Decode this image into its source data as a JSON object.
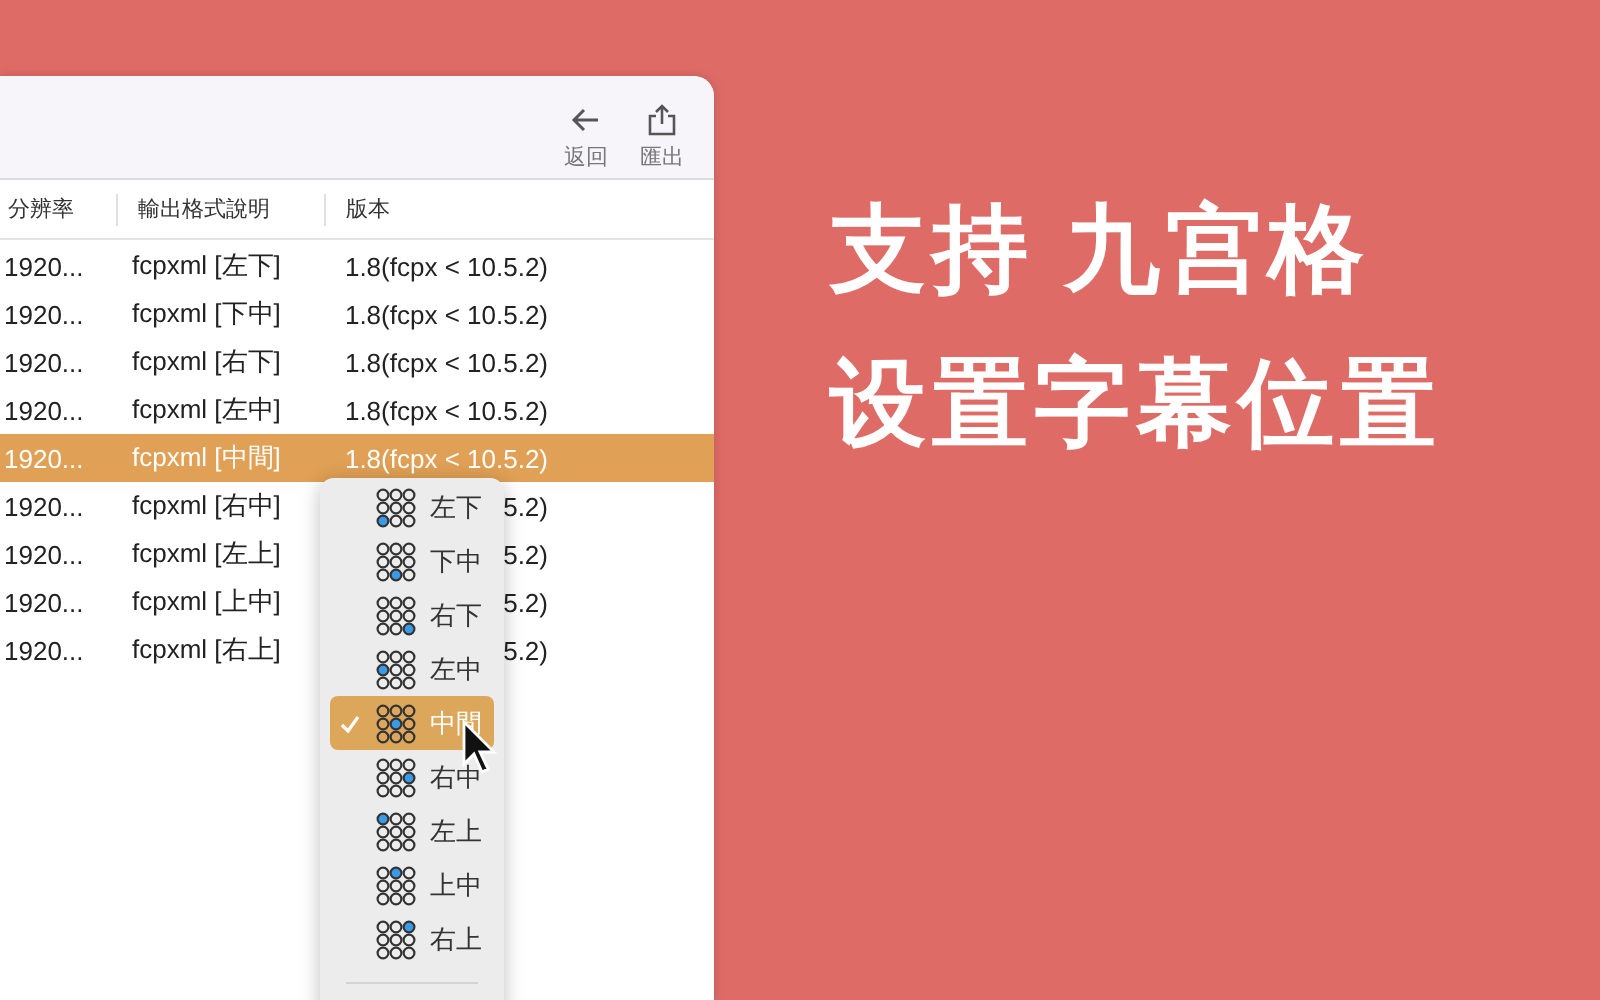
{
  "toolbar": {
    "buttons": [
      {
        "kind": "back",
        "label": "返回"
      },
      {
        "kind": "export",
        "label": "匯出"
      }
    ]
  },
  "table": {
    "columns": [
      "分辨率",
      "輸出格式說明",
      "版本"
    ],
    "rows": [
      {
        "cells": [
          "1920...",
          "fcpxml [左下]",
          "1.8(fcpx < 10.5.2)"
        ],
        "selected": false
      },
      {
        "cells": [
          "1920...",
          "fcpxml [下中]",
          "1.8(fcpx < 10.5.2)"
        ],
        "selected": false
      },
      {
        "cells": [
          "1920...",
          "fcpxml [右下]",
          "1.8(fcpx < 10.5.2)"
        ],
        "selected": false
      },
      {
        "cells": [
          "1920...",
          "fcpxml [左中]",
          "1.8(fcpx < 10.5.2)"
        ],
        "selected": false
      },
      {
        "cells": [
          "1920...",
          "fcpxml [中間]",
          "1.8(fcpx < 10.5.2)"
        ],
        "selected": true
      },
      {
        "cells": [
          "1920...",
          "fcpxml [右中]",
          "5.2)"
        ],
        "selected": false
      },
      {
        "cells": [
          "1920...",
          "fcpxml [左上]",
          "5.2)"
        ],
        "selected": false
      },
      {
        "cells": [
          "1920...",
          "fcpxml [上中]",
          "5.2)"
        ],
        "selected": false
      },
      {
        "cells": [
          "1920...",
          "fcpxml [右上]",
          "5.2)"
        ],
        "selected": false
      }
    ]
  },
  "menu": {
    "items": [
      {
        "label": "左下",
        "kind": "southwest",
        "selected": false
      },
      {
        "label": "下中",
        "kind": "south",
        "selected": false
      },
      {
        "label": "右下",
        "kind": "southeast",
        "selected": false
      },
      {
        "label": "左中",
        "kind": "west",
        "selected": false
      },
      {
        "label": "中間",
        "kind": "center",
        "selected": true
      },
      {
        "label": "右中",
        "kind": "east",
        "selected": false
      },
      {
        "label": "左上",
        "kind": "northwest",
        "selected": false
      },
      {
        "label": "上中",
        "kind": "north",
        "selected": false
      },
      {
        "label": "右上",
        "kind": "northeast",
        "selected": false
      }
    ]
  },
  "headline": [
    "支持 九宫格",
    "设置字幕位置"
  ]
}
